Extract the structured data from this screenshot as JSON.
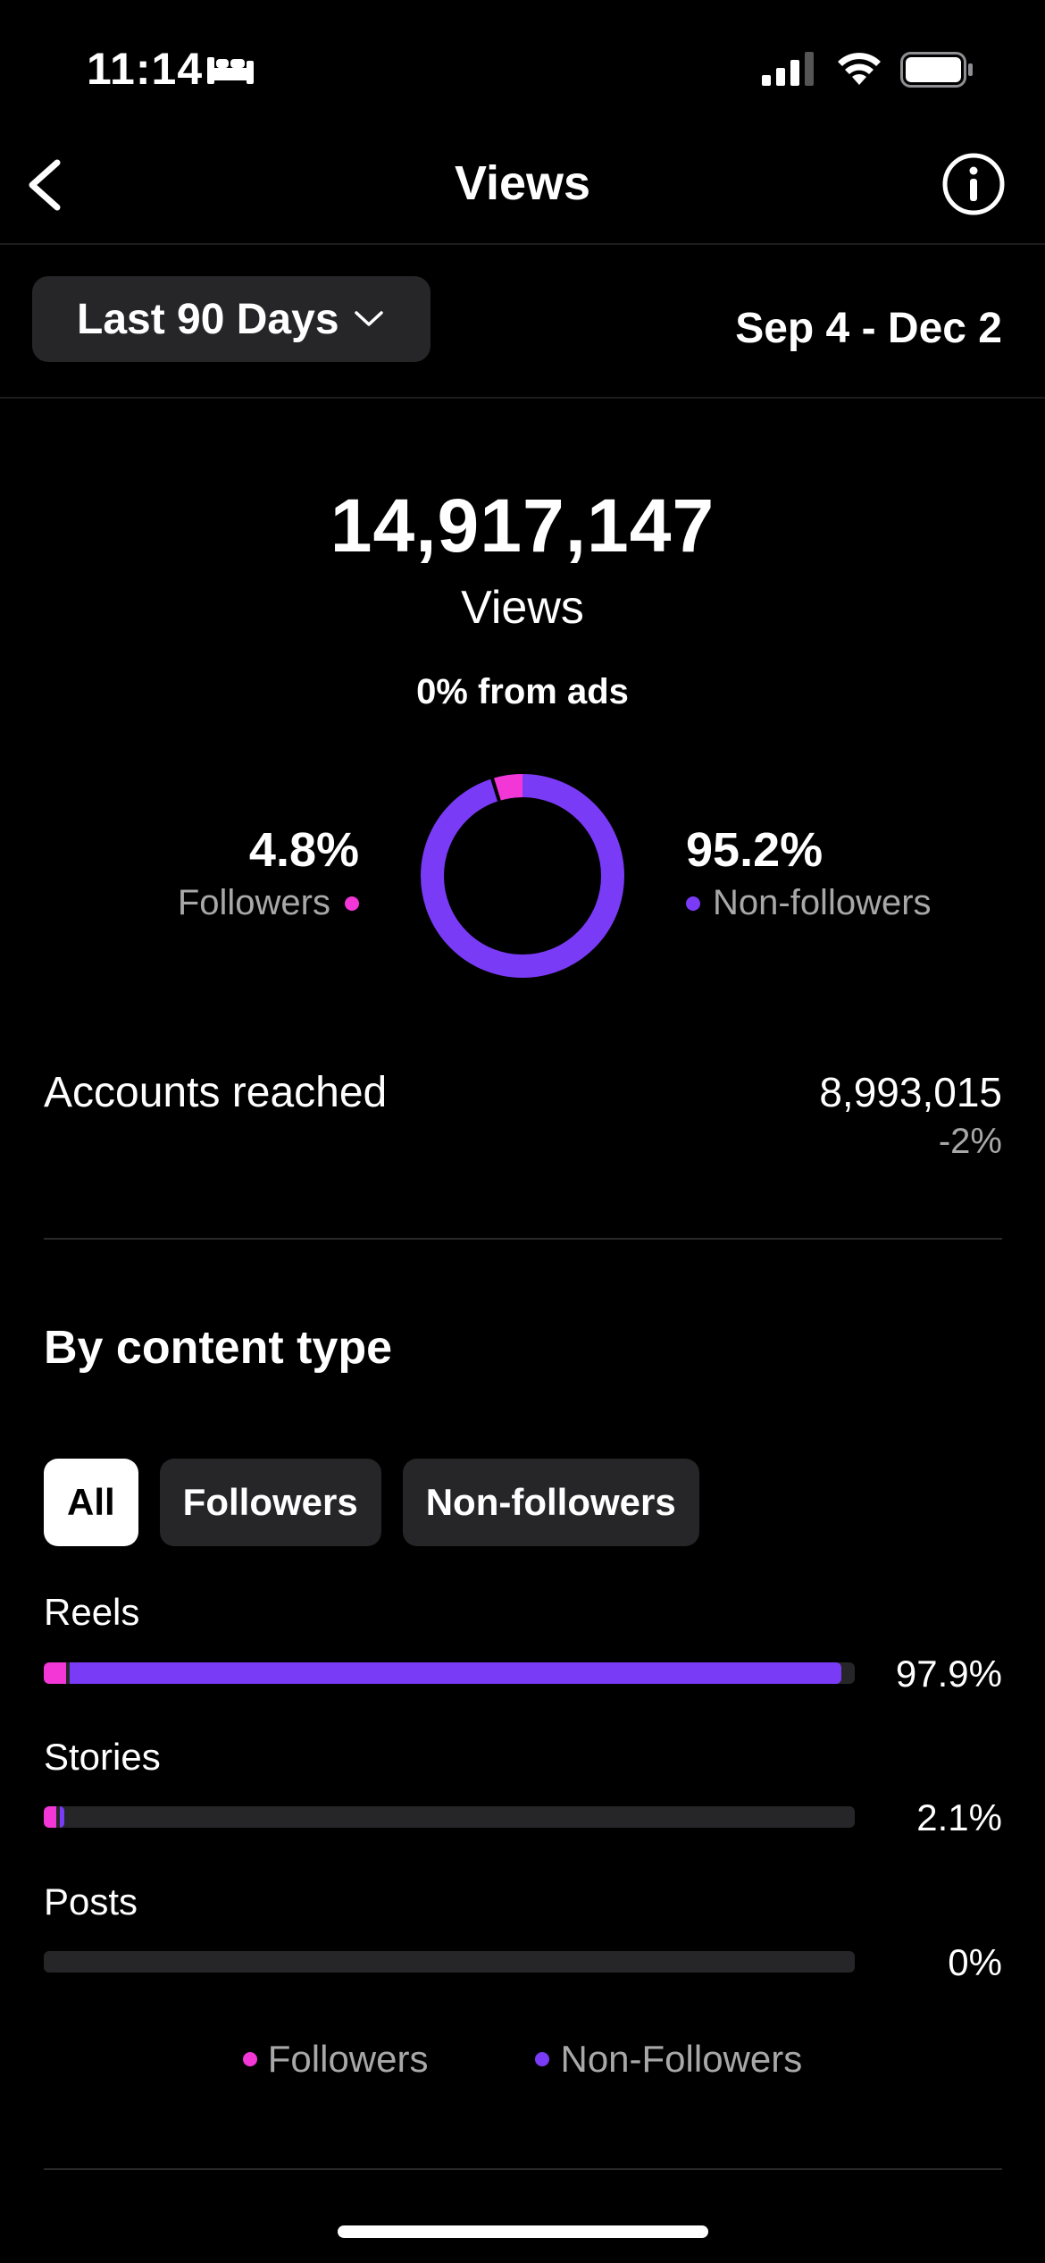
{
  "status_bar": {
    "time": "11:14"
  },
  "header": {
    "title": "Views"
  },
  "filter": {
    "range_label": "Last 90 Days",
    "date_range": "Sep 4 - Dec 2"
  },
  "summary": {
    "total": "14,917,147",
    "total_label": "Views",
    "ads_note": "0% from ads",
    "followers_pct": "4.8%",
    "followers_label": "Followers",
    "followers_fraction": 0.048,
    "nonfollowers_pct": "95.2%",
    "nonfollowers_label": "Non-followers"
  },
  "accounts": {
    "label": "Accounts reached",
    "value": "8,993,015",
    "delta": "-2%"
  },
  "content_type": {
    "title": "By content type",
    "chips": [
      "All",
      "Followers",
      "Non-followers"
    ],
    "active_chip": "All",
    "rows": [
      {
        "label": "Reels",
        "pct": "97.9%",
        "followers_fraction": 0.028,
        "nonfollowers_fraction": 0.951
      },
      {
        "label": "Stories",
        "pct": "2.1%",
        "followers_fraction": 0.015,
        "nonfollowers_fraction": 0.006
      },
      {
        "label": "Posts",
        "pct": "0%",
        "followers_fraction": 0,
        "nonfollowers_fraction": 0
      }
    ],
    "legend": {
      "followers": "Followers",
      "nonfollowers": "Non-Followers"
    }
  },
  "colors": {
    "followers": "#f336d6",
    "nonfollowers": "#7a3bf6",
    "track": "#262628"
  }
}
